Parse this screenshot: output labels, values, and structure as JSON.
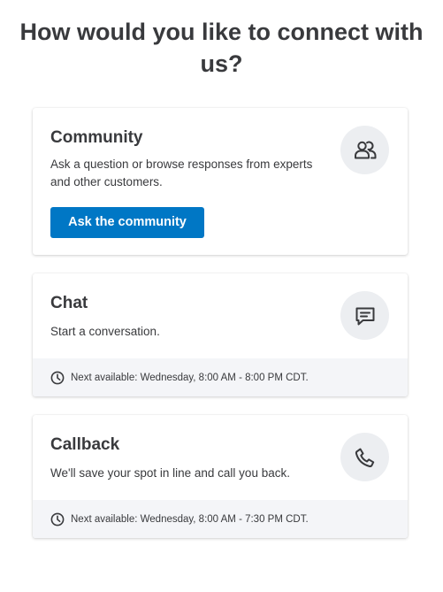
{
  "page": {
    "heading": "How would you like to connect with us?"
  },
  "community": {
    "title": "Community",
    "description": "Ask a question or browse responses from experts and other customers.",
    "button_label": "Ask the community",
    "icon": "people-icon"
  },
  "chat": {
    "title": "Chat",
    "description": "Start a conversation.",
    "availability": "Next available: Wednesday, 8:00 AM - 8:00 PM CDT.",
    "icon": "chat-bubble-icon"
  },
  "callback": {
    "title": "Callback",
    "description": "We'll save your spot in line and call you back.",
    "availability": "Next available: Wednesday, 8:00 AM - 7:30 PM CDT.",
    "icon": "phone-icon"
  },
  "colors": {
    "primary_button": "#0077c5",
    "text": "#393a3d",
    "icon_circle_bg": "#eceef1",
    "footer_bg": "#f4f5f8"
  }
}
